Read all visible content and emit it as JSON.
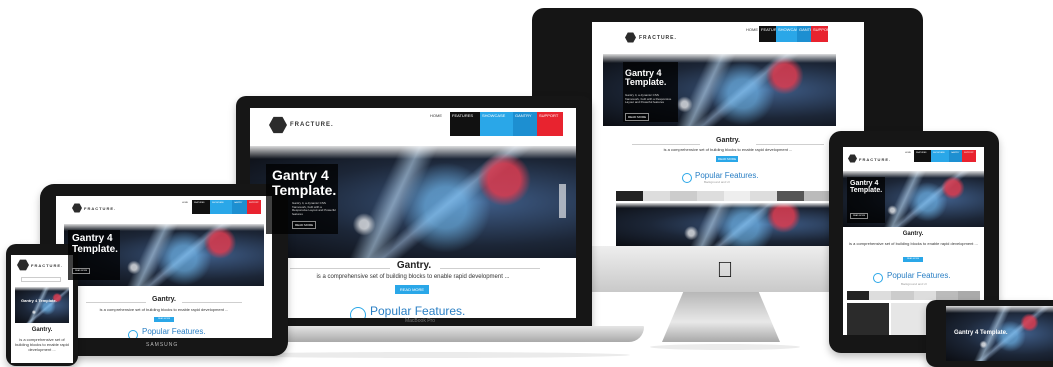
{
  "site": {
    "logo": "FRACTURE.",
    "hero_title": "Gantry 4\nTemplate.",
    "hero_title_phone": "Gantry 4 Template.",
    "hero_body": "Gantry 4, a dynamic CSS framework, built with a Responsive Layout and Powerful features",
    "hero_button": "READ MORE",
    "section_title": "Gantry.",
    "section_text": "is a comprehensive set of building blocks to enable rapid development ...",
    "read_more": "READ MORE",
    "popular_title": "Popular Features.",
    "popular_sub": "Background and UI",
    "nav": [
      "HOME",
      "FEATURES",
      "SHOWCASE",
      "GANTRY",
      "SUPPORT"
    ]
  },
  "devices": {
    "laptop_label": "MacBook Pro",
    "tablet_brand": "SAMSUNG"
  },
  "colors": {
    "accent_blue": "#2aa7e8",
    "accent_red": "#e8232f",
    "device_black": "#161616"
  }
}
